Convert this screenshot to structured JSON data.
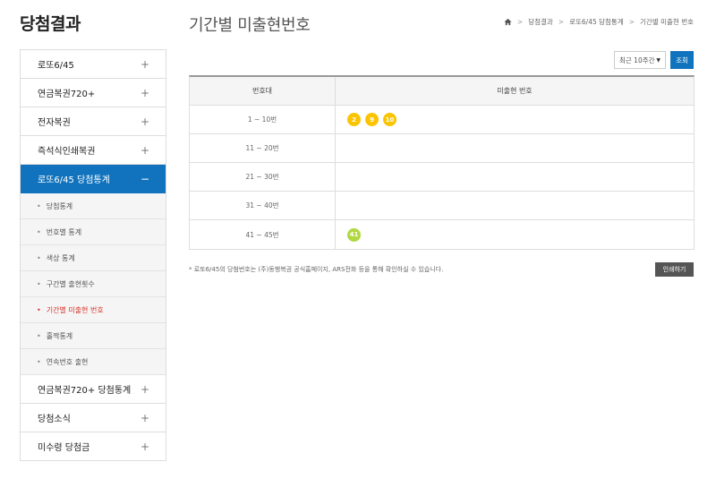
{
  "side_title": "당첨결과",
  "menu": {
    "before": [
      {
        "label": "로또6/45",
        "sign": "+"
      },
      {
        "label": "연금복권720+",
        "sign": "+"
      },
      {
        "label": "전자복권",
        "sign": "+"
      },
      {
        "label": "즉석식인쇄복권",
        "sign": "+"
      }
    ],
    "active": {
      "label": "로또6/45 당첨통계",
      "sign": "−"
    },
    "sub": [
      {
        "label": "당첨통계"
      },
      {
        "label": "번호별 통계"
      },
      {
        "label": "색상 통계"
      },
      {
        "label": "구간별 출현횟수"
      },
      {
        "label": "기간별 미출현 번호"
      },
      {
        "label": "홀짝통계"
      },
      {
        "label": "연속번호 출현"
      }
    ],
    "after": [
      {
        "label": "연금복권720+ 당첨통계",
        "sign": "+"
      },
      {
        "label": "당첨소식",
        "sign": "+"
      },
      {
        "label": "미수령 당첨금",
        "sign": "+"
      }
    ]
  },
  "page_title": "기간별 미출현번호",
  "breadcrumb": [
    "당첨결과",
    "로또6/45 당첨통계",
    "기간별 미출현 번호"
  ],
  "filter": {
    "select_value": "최근 10주간",
    "search_label": "조회"
  },
  "table": {
    "headers": [
      "번호대",
      "미출현 번호"
    ],
    "rows": [
      {
        "range": "1 ~ 10번",
        "balls": [
          {
            "n": "2",
            "color": "#fbc400"
          },
          {
            "n": "9",
            "color": "#fbc400"
          },
          {
            "n": "10",
            "color": "#fbc400"
          }
        ]
      },
      {
        "range": "11 ~ 20번",
        "balls": []
      },
      {
        "range": "21 ~ 30번",
        "balls": []
      },
      {
        "range": "31 ~ 40번",
        "balls": []
      },
      {
        "range": "41 ~ 45번",
        "balls": [
          {
            "n": "41",
            "color": "#b0d840"
          }
        ]
      }
    ]
  },
  "note": "* 로또6/45의 당첨번호는 (주)동행복권 공식홈페이지, ARS전화 등을 통해 확인하실 수 있습니다.",
  "print_label": "인쇄하기"
}
